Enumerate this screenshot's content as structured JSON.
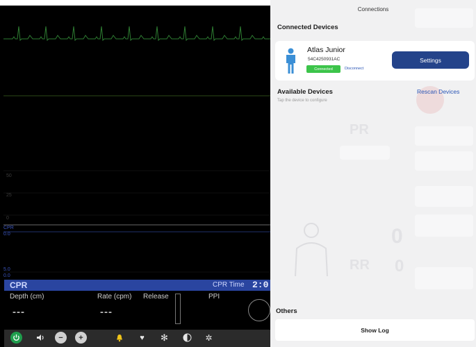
{
  "monitor": {
    "scale_labels": [
      "50",
      "25",
      "0",
      "CPR",
      "0.0",
      "5.0",
      "0.0"
    ],
    "cpr_bar": {
      "label": "CPR",
      "time_label": "CPR Time",
      "time_value": "2:0"
    },
    "cpr_fields": {
      "depth_label": "Depth (cm)",
      "depth_value": "---",
      "rate_label": "Rate (cpm)",
      "rate_value": "---",
      "release_label": "Release",
      "ppi_label": "PPI"
    },
    "toolbar_icons": [
      "power-icon",
      "volume-icon",
      "minus-icon",
      "plus-icon",
      "bell-icon",
      "heart-icon",
      "snowflake-icon",
      "contrast-icon",
      "gear-icon"
    ]
  },
  "background_ghost": {
    "pr_label": "PR",
    "rr_label": "RR",
    "value_0": "0",
    "value_1": "0"
  },
  "connections": {
    "title": "Connections",
    "connected_heading": "Connected Devices",
    "device": {
      "name": "Atlas Junior",
      "serial": "54C4250931AC",
      "status": "Connected",
      "disconnect": "Disconnect",
      "settings": "Settings"
    },
    "available_heading": "Available Devices",
    "available_hint": "Tap the device to configure",
    "rescan": "Rescan Devices",
    "others_heading": "Others",
    "show_log": "Show Log"
  },
  "colors": {
    "ecg_trace": "#2e7d32",
    "cpr_bar": "#2a45a0",
    "settings_button": "#24438a",
    "connected_badge": "#3cc44a",
    "link": "#2a55b5",
    "person_icon": "#3b8fd6"
  }
}
